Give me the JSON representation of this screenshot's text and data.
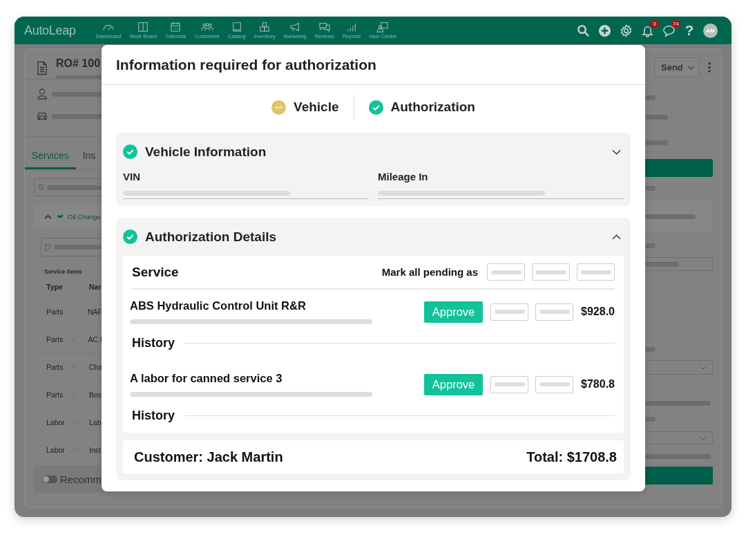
{
  "app": {
    "logo": "AutoLeap",
    "nav": [
      {
        "label": "Dashboard"
      },
      {
        "label": "Work Board"
      },
      {
        "label": "Calendar"
      },
      {
        "label": "Customers"
      },
      {
        "label": "Catalog"
      },
      {
        "label": "Inventory"
      },
      {
        "label": "Marketing"
      },
      {
        "label": "Reviews"
      },
      {
        "label": "Reports"
      },
      {
        "label": "User Center"
      }
    ],
    "notifications_badge": "3",
    "messages_badge": "74",
    "help": "?",
    "avatar": "AM"
  },
  "repair_order": {
    "title": "RO# 100",
    "tabs": [
      {
        "label": "Services",
        "selected": true
      },
      {
        "label": "Ins",
        "selected": false
      }
    ],
    "group": "Oil Change",
    "items_label": "Service Items",
    "columns": [
      "Type",
      "Nar"
    ],
    "rows": [
      {
        "type": "Parts",
        "name": "NAF"
      },
      {
        "type": "Parts",
        "name": "AC I"
      },
      {
        "type": "Parts",
        "name": "Cha"
      },
      {
        "type": "Parts",
        "name": "Bos"
      },
      {
        "type": "Labor",
        "name": "Lab"
      },
      {
        "type": "Labor",
        "name": "Inst"
      }
    ],
    "recommended": {
      "label": "Recomm",
      "on": false
    },
    "send_button": "Send"
  },
  "dialog": {
    "title": "Information required for authorization",
    "steps": [
      {
        "label": "Vehicle",
        "completed": false
      },
      {
        "label": "Authorization",
        "completed": true
      }
    ],
    "vehicle_section": {
      "title": "Vehicle Information",
      "fields": [
        "VIN",
        "Mileage In"
      ]
    },
    "authorization_section": {
      "title": "Authorization Details",
      "service_header": "Service",
      "mark_all_label": "Mark all pending as",
      "items": [
        {
          "name": "ABS Hydraulic Control Unit R&R",
          "action": "Approve",
          "price": "$928.0",
          "history_label": "History"
        },
        {
          "name": "A labor for canned service 3",
          "action": "Approve",
          "price": "$780.8",
          "history_label": "History"
        }
      ],
      "customer": "Customer: Jack Martin",
      "total": "Total: $1708.8"
    }
  }
}
